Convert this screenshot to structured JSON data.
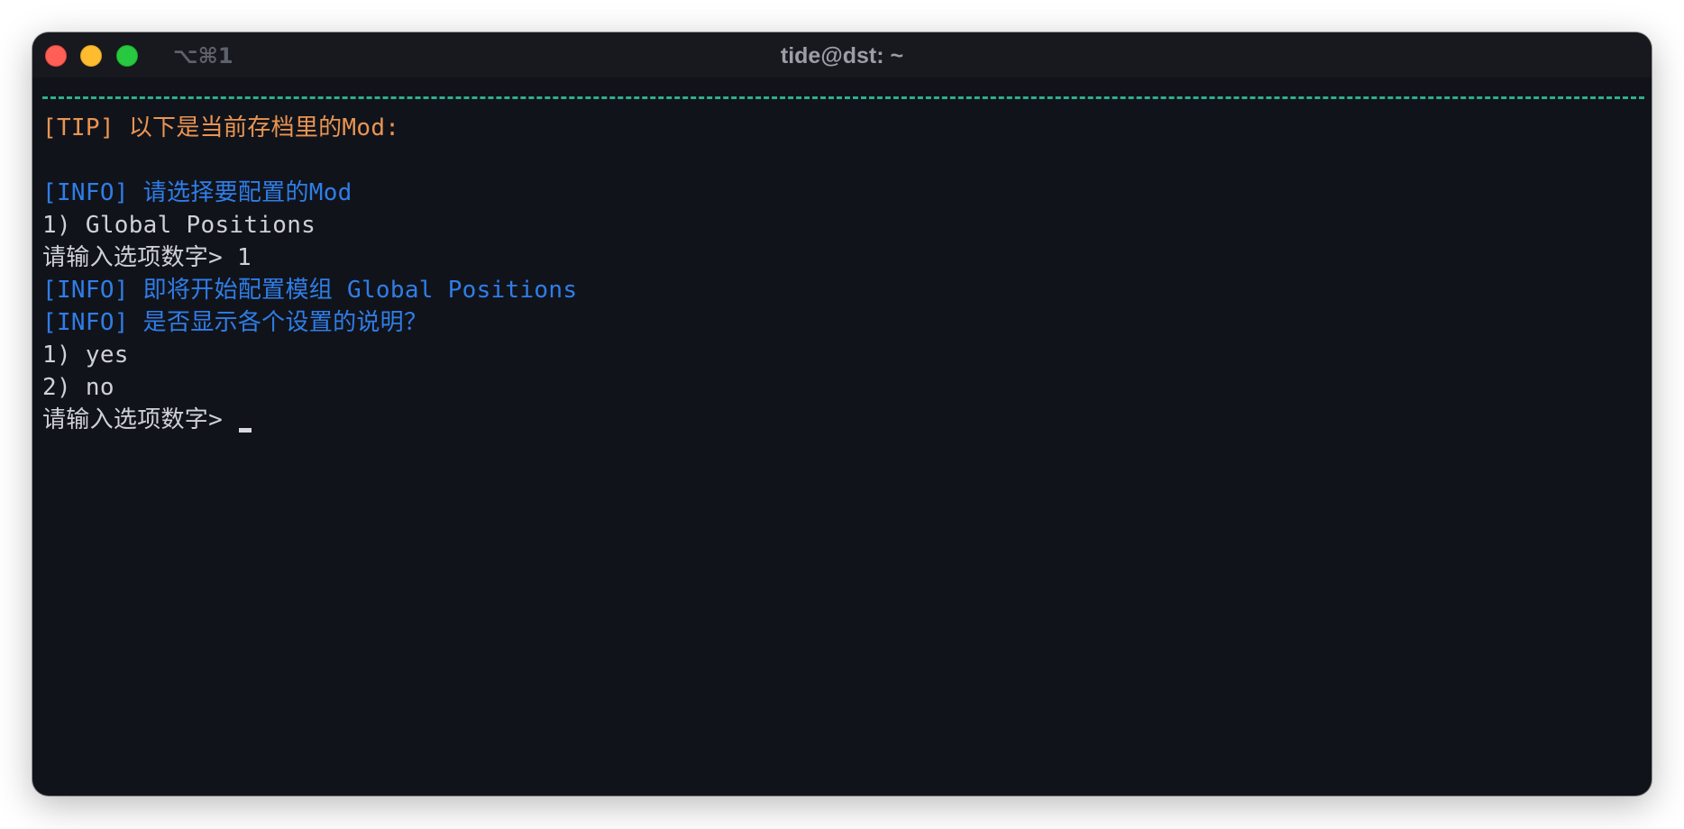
{
  "window": {
    "title": "tide@dst: ~",
    "shortcut": "⌥⌘1"
  },
  "terminal": {
    "lines": [
      {
        "kind": "tip",
        "text": "[TIP] 以下是当前存档里的Mod:"
      },
      {
        "kind": "blank",
        "text": ""
      },
      {
        "kind": "info",
        "text": "[INFO] 请选择要配置的Mod"
      },
      {
        "kind": "plain",
        "text": "1) Global Positions"
      },
      {
        "kind": "plain",
        "text": "请输入选项数字> 1"
      },
      {
        "kind": "info",
        "text": "[INFO] 即将开始配置模组 Global Positions"
      },
      {
        "kind": "info",
        "text": "[INFO] 是否显示各个设置的说明？"
      },
      {
        "kind": "plain",
        "text": "1) yes"
      },
      {
        "kind": "plain",
        "text": "2) no"
      }
    ],
    "prompt": "请输入选项数字> "
  },
  "colors": {
    "background": "#11131b",
    "tip": "#e99552",
    "info": "#2f7ee7",
    "plain": "#cfd1d7",
    "separator": "#2db08d"
  }
}
